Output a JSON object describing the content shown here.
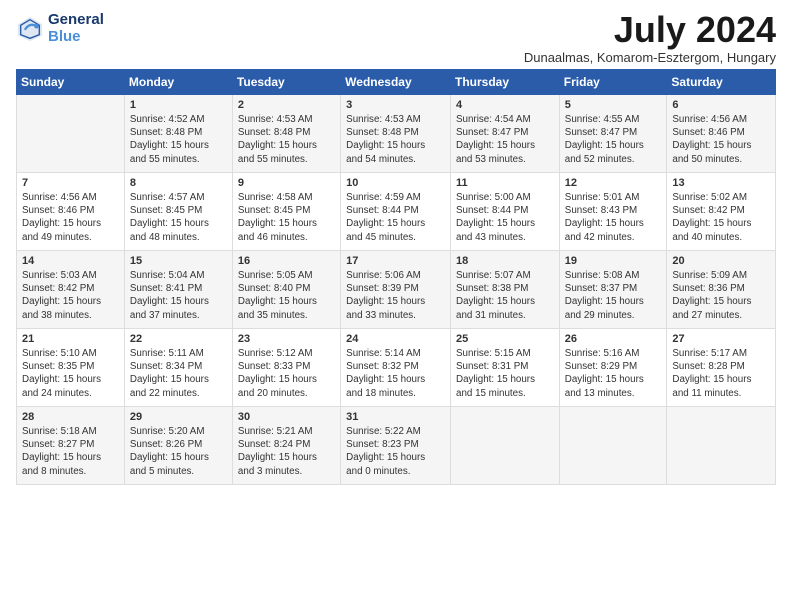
{
  "header": {
    "logo_line1": "General",
    "logo_line2": "Blue",
    "month_year": "July 2024",
    "location": "Dunaalmas, Komarom-Esztergom, Hungary"
  },
  "weekdays": [
    "Sunday",
    "Monday",
    "Tuesday",
    "Wednesday",
    "Thursday",
    "Friday",
    "Saturday"
  ],
  "weeks": [
    [
      {
        "day": "",
        "content": ""
      },
      {
        "day": "1",
        "content": "Sunrise: 4:52 AM\nSunset: 8:48 PM\nDaylight: 15 hours\nand 55 minutes."
      },
      {
        "day": "2",
        "content": "Sunrise: 4:53 AM\nSunset: 8:48 PM\nDaylight: 15 hours\nand 55 minutes."
      },
      {
        "day": "3",
        "content": "Sunrise: 4:53 AM\nSunset: 8:48 PM\nDaylight: 15 hours\nand 54 minutes."
      },
      {
        "day": "4",
        "content": "Sunrise: 4:54 AM\nSunset: 8:47 PM\nDaylight: 15 hours\nand 53 minutes."
      },
      {
        "day": "5",
        "content": "Sunrise: 4:55 AM\nSunset: 8:47 PM\nDaylight: 15 hours\nand 52 minutes."
      },
      {
        "day": "6",
        "content": "Sunrise: 4:56 AM\nSunset: 8:46 PM\nDaylight: 15 hours\nand 50 minutes."
      }
    ],
    [
      {
        "day": "7",
        "content": "Sunrise: 4:56 AM\nSunset: 8:46 PM\nDaylight: 15 hours\nand 49 minutes."
      },
      {
        "day": "8",
        "content": "Sunrise: 4:57 AM\nSunset: 8:45 PM\nDaylight: 15 hours\nand 48 minutes."
      },
      {
        "day": "9",
        "content": "Sunrise: 4:58 AM\nSunset: 8:45 PM\nDaylight: 15 hours\nand 46 minutes."
      },
      {
        "day": "10",
        "content": "Sunrise: 4:59 AM\nSunset: 8:44 PM\nDaylight: 15 hours\nand 45 minutes."
      },
      {
        "day": "11",
        "content": "Sunrise: 5:00 AM\nSunset: 8:44 PM\nDaylight: 15 hours\nand 43 minutes."
      },
      {
        "day": "12",
        "content": "Sunrise: 5:01 AM\nSunset: 8:43 PM\nDaylight: 15 hours\nand 42 minutes."
      },
      {
        "day": "13",
        "content": "Sunrise: 5:02 AM\nSunset: 8:42 PM\nDaylight: 15 hours\nand 40 minutes."
      }
    ],
    [
      {
        "day": "14",
        "content": "Sunrise: 5:03 AM\nSunset: 8:42 PM\nDaylight: 15 hours\nand 38 minutes."
      },
      {
        "day": "15",
        "content": "Sunrise: 5:04 AM\nSunset: 8:41 PM\nDaylight: 15 hours\nand 37 minutes."
      },
      {
        "day": "16",
        "content": "Sunrise: 5:05 AM\nSunset: 8:40 PM\nDaylight: 15 hours\nand 35 minutes."
      },
      {
        "day": "17",
        "content": "Sunrise: 5:06 AM\nSunset: 8:39 PM\nDaylight: 15 hours\nand 33 minutes."
      },
      {
        "day": "18",
        "content": "Sunrise: 5:07 AM\nSunset: 8:38 PM\nDaylight: 15 hours\nand 31 minutes."
      },
      {
        "day": "19",
        "content": "Sunrise: 5:08 AM\nSunset: 8:37 PM\nDaylight: 15 hours\nand 29 minutes."
      },
      {
        "day": "20",
        "content": "Sunrise: 5:09 AM\nSunset: 8:36 PM\nDaylight: 15 hours\nand 27 minutes."
      }
    ],
    [
      {
        "day": "21",
        "content": "Sunrise: 5:10 AM\nSunset: 8:35 PM\nDaylight: 15 hours\nand 24 minutes."
      },
      {
        "day": "22",
        "content": "Sunrise: 5:11 AM\nSunset: 8:34 PM\nDaylight: 15 hours\nand 22 minutes."
      },
      {
        "day": "23",
        "content": "Sunrise: 5:12 AM\nSunset: 8:33 PM\nDaylight: 15 hours\nand 20 minutes."
      },
      {
        "day": "24",
        "content": "Sunrise: 5:14 AM\nSunset: 8:32 PM\nDaylight: 15 hours\nand 18 minutes."
      },
      {
        "day": "25",
        "content": "Sunrise: 5:15 AM\nSunset: 8:31 PM\nDaylight: 15 hours\nand 15 minutes."
      },
      {
        "day": "26",
        "content": "Sunrise: 5:16 AM\nSunset: 8:29 PM\nDaylight: 15 hours\nand 13 minutes."
      },
      {
        "day": "27",
        "content": "Sunrise: 5:17 AM\nSunset: 8:28 PM\nDaylight: 15 hours\nand 11 minutes."
      }
    ],
    [
      {
        "day": "28",
        "content": "Sunrise: 5:18 AM\nSunset: 8:27 PM\nDaylight: 15 hours\nand 8 minutes."
      },
      {
        "day": "29",
        "content": "Sunrise: 5:20 AM\nSunset: 8:26 PM\nDaylight: 15 hours\nand 5 minutes."
      },
      {
        "day": "30",
        "content": "Sunrise: 5:21 AM\nSunset: 8:24 PM\nDaylight: 15 hours\nand 3 minutes."
      },
      {
        "day": "31",
        "content": "Sunrise: 5:22 AM\nSunset: 8:23 PM\nDaylight: 15 hours\nand 0 minutes."
      },
      {
        "day": "",
        "content": ""
      },
      {
        "day": "",
        "content": ""
      },
      {
        "day": "",
        "content": ""
      }
    ]
  ]
}
